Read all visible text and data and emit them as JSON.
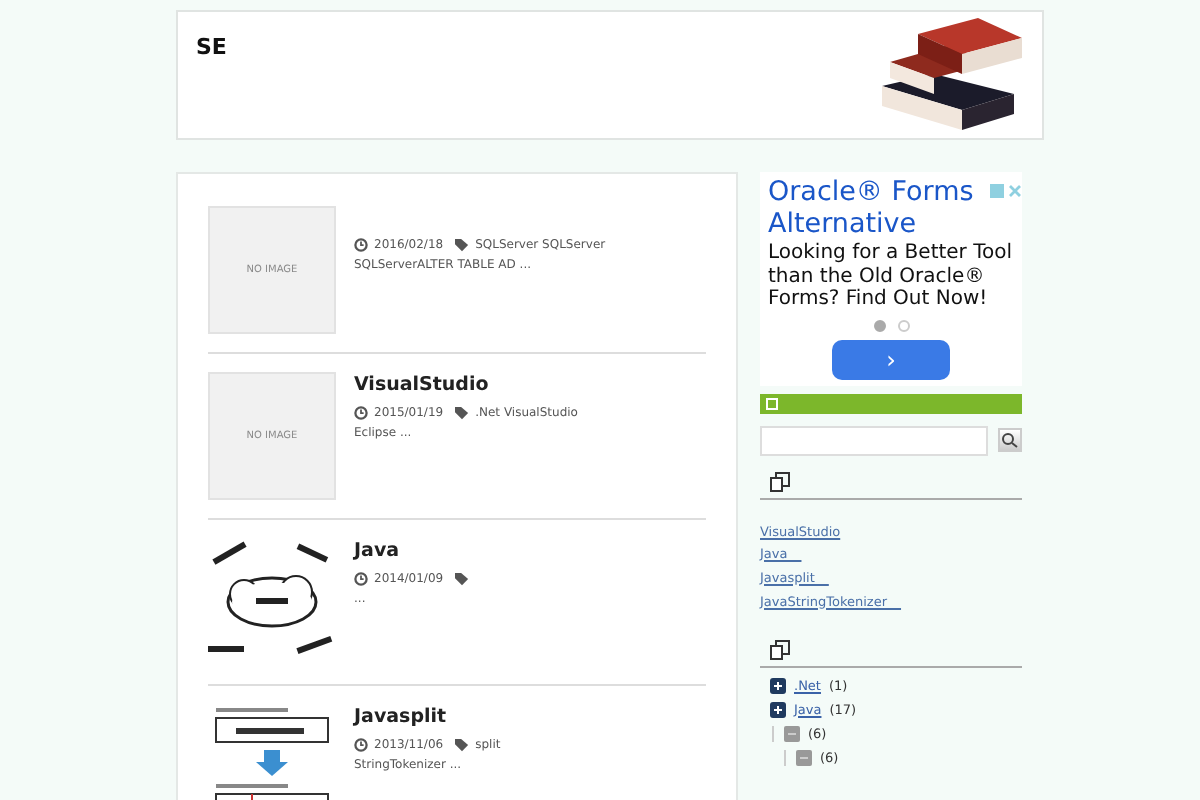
{
  "site": {
    "title": "SE"
  },
  "posts": [
    {
      "date": "2016/02/18",
      "tags": "SQLServer SQLServer",
      "excerpt": "SQLServerALTER TABLE AD ...",
      "thumb": {
        "kind": "no-image",
        "label": "NO IMAGE"
      }
    },
    {
      "title": "VisualStudio",
      "date": "2015/01/19",
      "tags": ".Net VisualStudio",
      "excerpt": "Eclipse ...",
      "thumb": {
        "kind": "no-image",
        "label": "NO IMAGE"
      }
    },
    {
      "title": "Java",
      "date": "2014/01/09",
      "excerpt": "..."
    },
    {
      "title": "Javasplit",
      "date": "2013/11/06",
      "tags": "split",
      "excerpt": "StringTokenizer ..."
    }
  ],
  "ad": {
    "title": "Oracle® Forms Alternative",
    "body": "Looking for a Better Tool than the Old Oracle® Forms? Find Out Now!",
    "dots": [
      {
        "selected": true
      },
      {
        "selected": false
      }
    ],
    "button": "›"
  },
  "recent": [
    "VisualStudio",
    "Java　",
    "Javasplit　",
    "JavaStringTokenizer　"
  ],
  "categories": [
    {
      "label": ".Net",
      "count": "(1)"
    },
    {
      "label": "Java",
      "count": "(17)",
      "children": [
        {
          "count": "(6)",
          "children": [
            {
              "count": "(6)"
            }
          ]
        }
      ]
    }
  ]
}
